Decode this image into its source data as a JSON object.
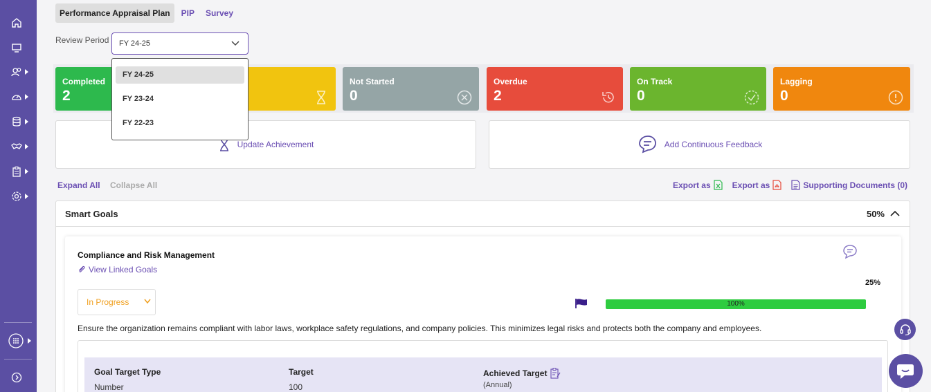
{
  "tabs": [
    {
      "label": "Performance Appraisal Plan",
      "active": true
    },
    {
      "label": "PIP",
      "active": false
    },
    {
      "label": "Survey",
      "active": false
    }
  ],
  "review_period": {
    "label": "Review Period",
    "selected": "FY 24-25",
    "options": [
      "FY 24-25",
      "FY 23-24",
      "FY 22-23"
    ]
  },
  "status_cards": [
    {
      "label": "Completed",
      "value": "2",
      "color": "#2db94d",
      "icon": "check-icon"
    },
    {
      "label": "",
      "value": "",
      "color": "#f1c40f",
      "icon": "hourglass-icon"
    },
    {
      "label": "Not Started",
      "value": "0",
      "color": "#95a5a6",
      "icon": "x-circle-icon"
    },
    {
      "label": "Overdue",
      "value": "2",
      "color": "#e74c3c",
      "icon": "rotate-left-icon"
    },
    {
      "label": "On Track",
      "value": "0",
      "color": "#6bb52e",
      "icon": "check-circle-icon"
    },
    {
      "label": "Lagging",
      "value": "0",
      "color": "#f0870e",
      "icon": "alert-circle-icon"
    }
  ],
  "actions": {
    "update_achievement": "Update Achievement",
    "add_feedback": "Add Continuous Feedback"
  },
  "toolbar": {
    "expand_all": "Expand All",
    "collapse_all": "Collapse All",
    "export_excel": "Export as",
    "export_pdf": "Export as",
    "supporting_docs": "Supporting Documents (0)"
  },
  "smart_goals": {
    "title": "Smart Goals",
    "percent": "50%",
    "goal": {
      "title": "Compliance and Risk Management",
      "linked_link": "View Linked Goals",
      "weight": "25%",
      "status": "In Progress",
      "progress_label": "100%",
      "progress": 1.0,
      "description": "Ensure the organization remains compliant with labor laws, workplace safety regulations, and company policies. This minimizes legal risks and protects both the company and employees.",
      "table": {
        "col_type": "Goal Target Type",
        "col_target": "Target",
        "col_achieved": "Achieved Target",
        "type_value": "Number",
        "target_value": "100",
        "achieved_sub": "(Annual)"
      }
    }
  },
  "colors": {
    "sidebar": "#5b4fa3",
    "accent": "#6b4fb3",
    "progress": "#2ecc40"
  }
}
